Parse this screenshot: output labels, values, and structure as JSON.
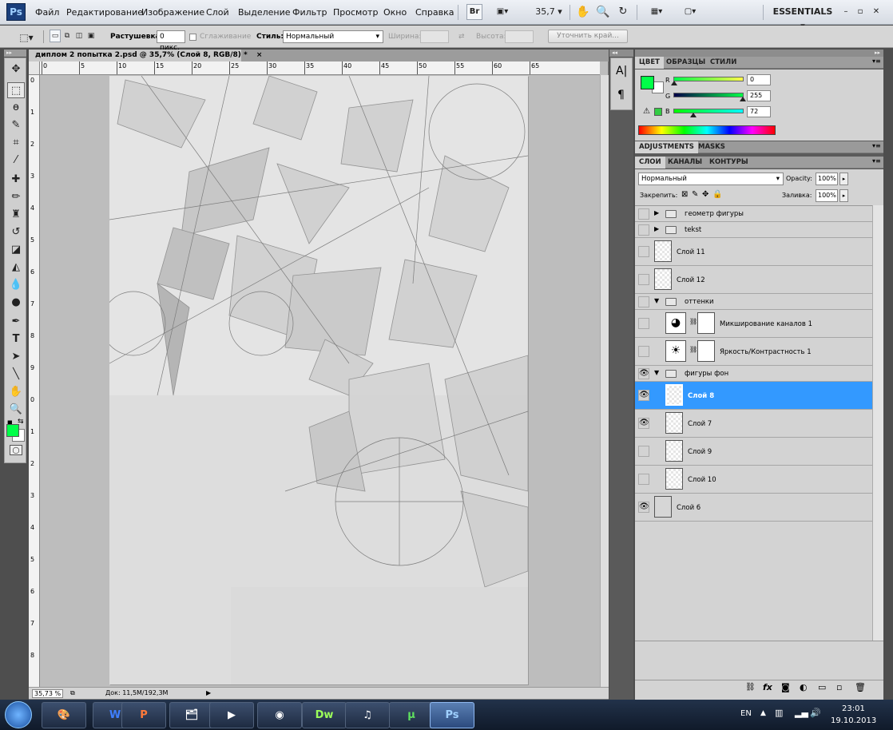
{
  "menubar": {
    "logo": "Ps",
    "items": [
      "Файл",
      "Редактирование",
      "Изображение",
      "Слой",
      "Выделение",
      "Фильтр",
      "Просмотр",
      "Окно",
      "Справка"
    ],
    "br_label": "Br",
    "zoom_value": "35,7",
    "workspace": "ESSENTIALS",
    "window_controls": [
      "–",
      "▫",
      "✕"
    ]
  },
  "options": {
    "feather_label": "Растушевка:",
    "feather_value": "0 пикс.",
    "antialias_label": "Сглаживание",
    "style_label": "Стиль:",
    "style_value": "Нормальный",
    "width_label": "Ширина:",
    "height_label": "Высота:",
    "refine_label": "Уточнить край..."
  },
  "document": {
    "tab_title": "диплом 2 попытка 2.psd @ 35,7% (Слой 8, RGB/8) *",
    "tab_close": "×",
    "ruler_h": [
      "0",
      "5",
      "10",
      "15",
      "20",
      "25",
      "30",
      "35",
      "40",
      "45",
      "50",
      "55",
      "60",
      "65"
    ],
    "ruler_v": [
      "0",
      "1",
      "2",
      "3",
      "4",
      "5",
      "6",
      "7",
      "8",
      "9",
      "0",
      "1",
      "2",
      "3",
      "4",
      "5",
      "6",
      "7",
      "8"
    ],
    "zoom": "35,73 %",
    "doc_size": "Док: 11,5M/192,3M"
  },
  "color_panel": {
    "tabs": [
      "ЦВЕТ",
      "ОБРАЗЦЫ",
      "СТИЛИ"
    ],
    "channels": [
      {
        "label": "R",
        "value": "0",
        "fraction": 0
      },
      {
        "label": "G",
        "value": "255",
        "fraction": 1
      },
      {
        "label": "B",
        "value": "72",
        "fraction": 0.28
      }
    ],
    "foreground": "#00ff48"
  },
  "adjust_panel": {
    "tabs": [
      "ADJUSTMENTS",
      "MASKS"
    ]
  },
  "layers_panel": {
    "tabs": [
      "СЛОИ",
      "КАНАЛЫ",
      "КОНТУРЫ"
    ],
    "blend_mode": "Нормальный",
    "opacity_label": "Opacity:",
    "opacity_value": "100%",
    "lock_label": "Закрепить:",
    "fill_label": "Заливка:",
    "fill_value": "100%",
    "layers": [
      {
        "name": "геометр фигуры",
        "type": "group",
        "visible": false,
        "indent": 0,
        "expanded": false
      },
      {
        "name": "tekst",
        "type": "group",
        "visible": false,
        "indent": 0,
        "expanded": false
      },
      {
        "name": "Слой 11",
        "type": "layer",
        "visible": false,
        "indent": 0
      },
      {
        "name": "Слой 12",
        "type": "layer",
        "visible": false,
        "indent": 0
      },
      {
        "name": "оттенки",
        "type": "group",
        "visible": false,
        "indent": 0,
        "expanded": true
      },
      {
        "name": "Микширование каналов 1",
        "type": "adjustment",
        "visible": false,
        "indent": 1
      },
      {
        "name": "Яркость/Контрастность 1",
        "type": "adjustment",
        "visible": false,
        "indent": 1
      },
      {
        "name": "фигуры фон",
        "type": "group",
        "visible": true,
        "indent": 0,
        "expanded": true
      },
      {
        "name": "Слой 8",
        "type": "layer",
        "visible": true,
        "indent": 1,
        "selected": true
      },
      {
        "name": "Слой 7",
        "type": "layer",
        "visible": true,
        "indent": 1
      },
      {
        "name": "Слой 9",
        "type": "layer",
        "visible": false,
        "indent": 1
      },
      {
        "name": "Слой 10",
        "type": "layer",
        "visible": false,
        "indent": 1
      },
      {
        "name": "Слой 6",
        "type": "layer",
        "visible": true,
        "indent": 0
      }
    ]
  },
  "taskbar": {
    "apps": [
      "W",
      "P",
      "Dw",
      "Ps"
    ],
    "lang": "EN",
    "time": "23:01",
    "date": "19.10.2013"
  }
}
